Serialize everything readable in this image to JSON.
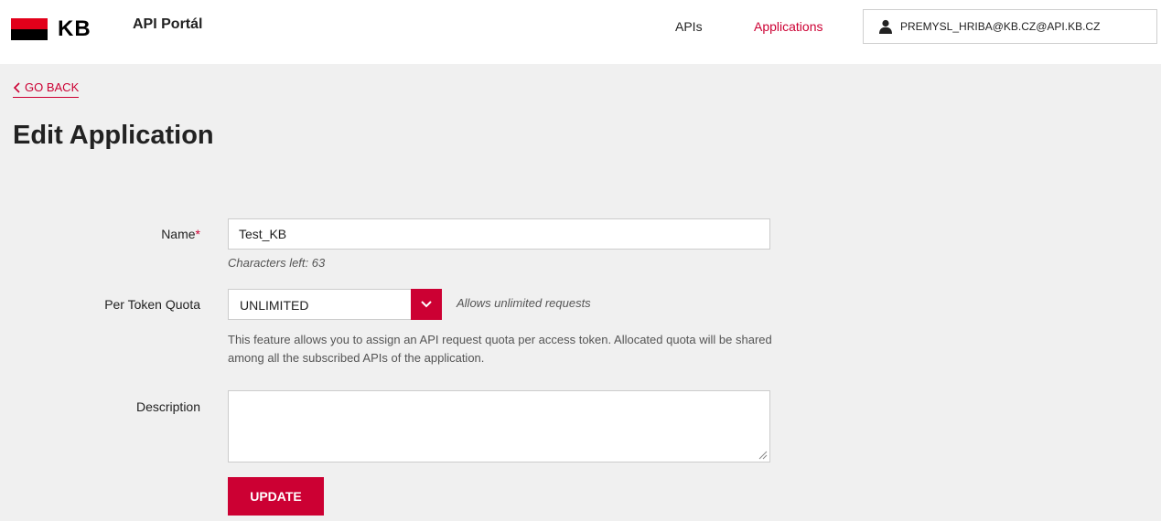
{
  "brand": {
    "logo_text": "KB",
    "portal_title": "API Portál",
    "accent_color": "#cc0033",
    "logo_red": "#e2001a"
  },
  "nav": {
    "apis_label": "APIs",
    "applications_label": "Applications",
    "user_email": "PREMYSL_HRIBA@KB.CZ@API.KB.CZ",
    "user_icon": "user-icon"
  },
  "page": {
    "go_back": "GO BACK",
    "title": "Edit Application"
  },
  "form": {
    "name_label": "Name",
    "required_mark": "*",
    "name_value": "Test_KB",
    "chars_left": "Characters left: 63",
    "quota_label": "Per Token Quota",
    "quota_value": "UNLIMITED",
    "quota_hint": "Allows unlimited requests",
    "quota_description": "This feature allows you to assign an API request quota per access token. Allocated quota will be shared among all the subscribed APIs of the application.",
    "description_label": "Description",
    "description_value": "",
    "update_label": "UPDATE"
  }
}
